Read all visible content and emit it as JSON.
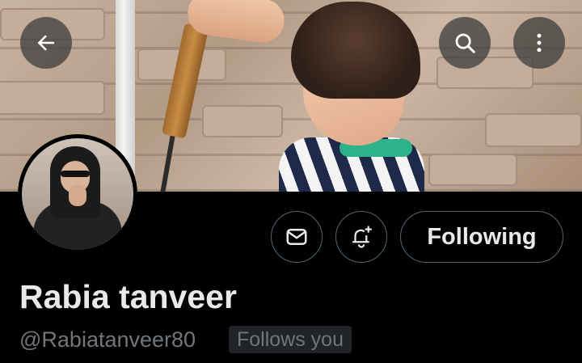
{
  "header": {
    "back_icon": "arrow-left-icon",
    "search_icon": "search-icon",
    "more_icon": "more-vertical-icon"
  },
  "profile": {
    "display_name": "Rabia tanveer",
    "handle": "@Rabiatanveer80",
    "follows_you_badge": "Follows you"
  },
  "actions": {
    "message_icon": "envelope-icon",
    "notify_icon": "bell-plus-icon",
    "follow_label": "Following"
  },
  "colors": {
    "background": "#000000",
    "text_primary": "#e7e9ea",
    "text_secondary": "#71767b",
    "border": "#536471",
    "badge_bg": "#202327"
  }
}
